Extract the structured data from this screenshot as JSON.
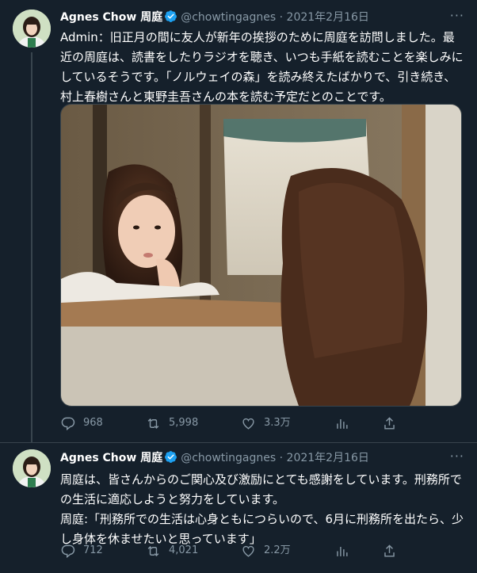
{
  "tweets": [
    {
      "author_name": "Agnes Chow 周庭",
      "handle": "@chowtingagnes",
      "separator": "·",
      "date": "2021年2月16日",
      "text": "Admin：旧正月の間に友人が新年の挨拶のために周庭を訪問しました。最近の周庭は、読書をしたりラジオを聴き、いつも手紙を読むことを楽しみにしているそうです。「ノルウェイの森」を読み終えたばかりで、引き続き、村上春樹さんと東野圭吾さんの本を読む予定だとのことです。",
      "replies": "968",
      "retweets": "5,998",
      "likes": "3.3万"
    },
    {
      "author_name": "Agnes Chow 周庭",
      "handle": "@chowtingagnes",
      "separator": "·",
      "date": "2021年2月16日",
      "text_line1": "周庭は、皆さんからのご関心及び激励にとても感謝をしています。刑務所での生活に適応しようと努力をしています。",
      "text_line2": "周庭:「刑務所での生活は心身ともにつらいので、6月に刑務所を出たら、少し身体を休ませたいと思っています」",
      "replies": "712",
      "retweets": "4,021",
      "likes": "2.2万"
    }
  ],
  "icons": {
    "reply": "comment-bubble-icon",
    "retweet": "retweet-icon",
    "like": "heart-icon",
    "stats": "analytics-icon",
    "share": "share-icon",
    "more": "more-dots-icon",
    "verified": "verified-badge-icon"
  },
  "colors": {
    "background": "#15202b",
    "secondary_text": "#8899a6",
    "verified": "#1da1f2",
    "divider": "#38444d"
  }
}
